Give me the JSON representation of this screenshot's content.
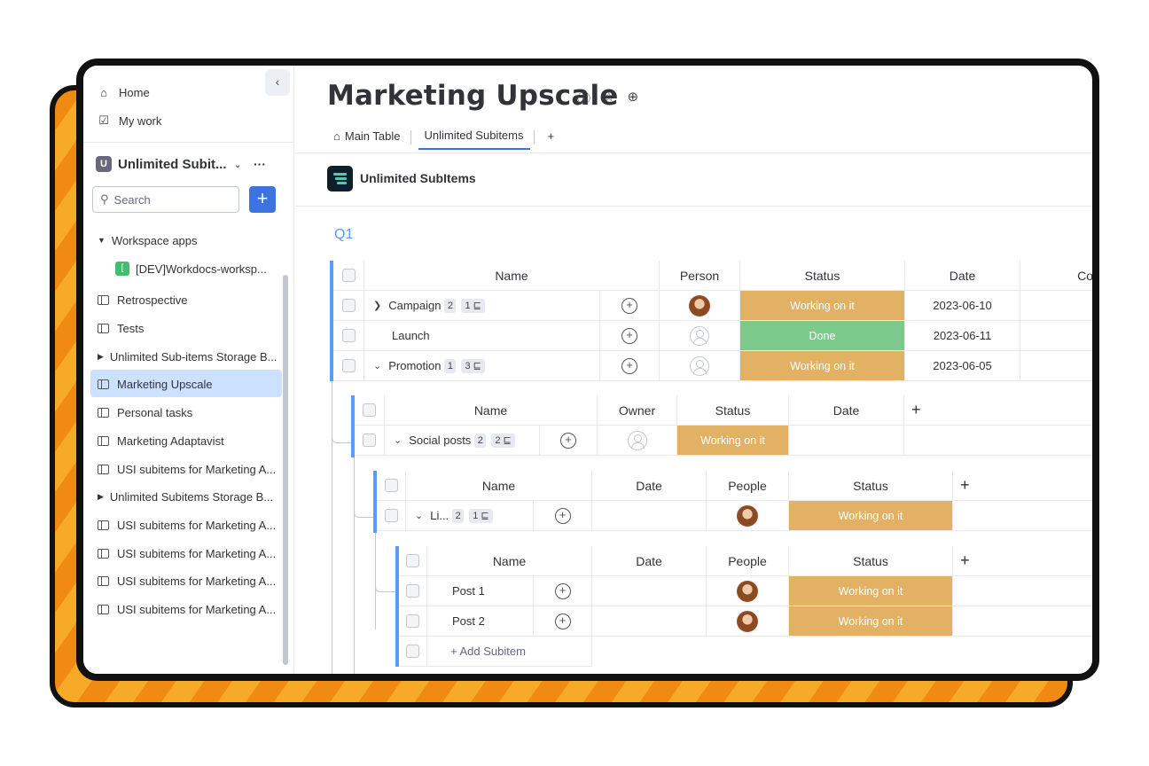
{
  "sidebar": {
    "home": "Home",
    "my_work": "My work",
    "workspace_badge": "U",
    "workspace_name": "Unlimited Subit...",
    "workspace_more": "···",
    "search_placeholder": "Search",
    "add_label": "+",
    "workspace_apps": "Workspace apps",
    "app_badge": "[",
    "app_name": "[DEV]Workdocs-worksp...",
    "items": [
      {
        "label": "Retrospective"
      },
      {
        "label": "Tests"
      },
      {
        "label": "Unlimited Sub-items Storage B..."
      },
      {
        "label": "Marketing Upscale"
      },
      {
        "label": "Personal tasks"
      },
      {
        "label": "Marketing Adaptavist"
      },
      {
        "label": "USI subitems for Marketing A..."
      },
      {
        "label": "Unlimited Subitems Storage B..."
      },
      {
        "label": "USI subitems for Marketing A..."
      },
      {
        "label": "USI subitems for Marketing A..."
      },
      {
        "label": "USI subitems for Marketing A..."
      },
      {
        "label": "USI subitems for Marketing A..."
      }
    ]
  },
  "header": {
    "title": "Marketing Upscale",
    "tabs": [
      "Main Table",
      "Unlimited Subitems"
    ],
    "add_tab": "+",
    "app_title": "Unlimited SubItems"
  },
  "group": {
    "label": "Q1"
  },
  "main_table": {
    "columns": [
      "Name",
      "Person",
      "Status",
      "Date",
      "Co"
    ],
    "rows": [
      {
        "name": "Campaign",
        "count": "2",
        "subitems": "1",
        "status": "Working on it",
        "date": "2023-06-10"
      },
      {
        "name": "Launch",
        "count": "",
        "subitems": "",
        "status": "Done",
        "date": "2023-06-11"
      },
      {
        "name": "Promotion",
        "count": "1",
        "subitems": "3",
        "status": "Working on it",
        "date": "2023-06-05"
      }
    ]
  },
  "sub1": {
    "columns": [
      "Name",
      "Owner",
      "Status",
      "Date",
      "+"
    ],
    "rows": [
      {
        "name": "Social posts",
        "count": "2",
        "subitems": "2",
        "status": "Working on it"
      }
    ]
  },
  "sub2": {
    "columns": [
      "Name",
      "Date",
      "People",
      "Status",
      "+"
    ],
    "rows": [
      {
        "name": "Li...",
        "count": "2",
        "subitems": "1",
        "status": "Working on it"
      }
    ]
  },
  "sub3": {
    "columns": [
      "Name",
      "Date",
      "People",
      "Status",
      "+"
    ],
    "rows": [
      {
        "name": "Post 1",
        "status": "Working on it"
      },
      {
        "name": "Post 2",
        "status": "Working on it"
      }
    ],
    "add_label": "+ Add Subitem"
  },
  "colors": {
    "accent": "#579bfc",
    "working": "#e2b163",
    "done": "#7bc98b",
    "frame_orange": "#f08a12"
  }
}
